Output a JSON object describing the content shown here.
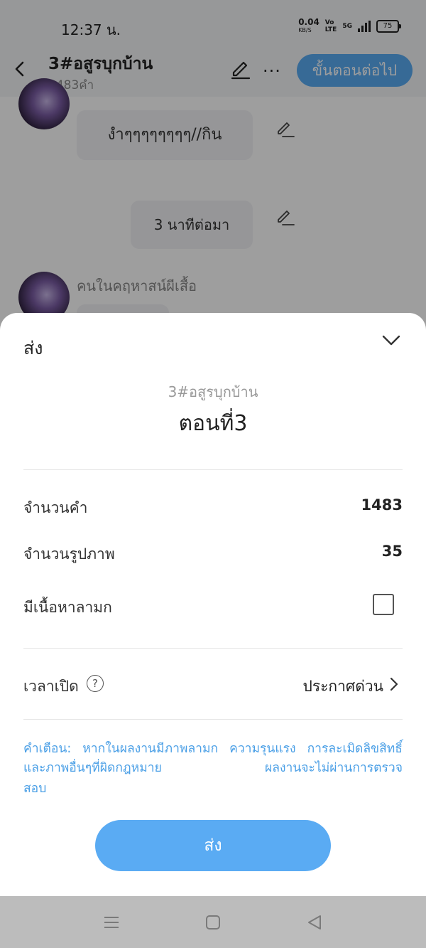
{
  "status_bar": {
    "time": "12:37 น.",
    "net_speed_value": "0.04",
    "net_speed_unit": "KB/S",
    "volte_top": "Vo",
    "volte_bottom": "LTE",
    "network": "5G",
    "battery": "75"
  },
  "header": {
    "title": "3#อสูรบุกบ้าน",
    "word_count": "1483คำ",
    "next_button": "ขั้นตอนต่อไป"
  },
  "chat": {
    "bubble_1": "งำๆๆๆๆๆๆๆๆ//กิน",
    "bubble_2": "3 นาทีต่อมา",
    "sender": "คนในคฤหาสน์ผีเสื้อ"
  },
  "sheet": {
    "title": "ส่ง",
    "book_name": "3#อสูรบุกบ้าน",
    "chapter_name": "ตอนที่3",
    "rows": {
      "word_count_label": "จำนวนคำ",
      "word_count_value": "1483",
      "image_count_label": "จำนวนรูปภาพ",
      "image_count_value": "35",
      "adult_label": "มีเนื้อหาลามก",
      "adult_checked": false,
      "publish_time_label": "เวลาเปิด",
      "publish_time_value": "ประกาศด่วน"
    },
    "warning_line": "คำเตือน: หากในผลงานมีภาพลามก ความรุนแรง การละเมิดลิขสิทธิ์และภาพอื่นๆที่ผิดกฎหมาย ผลงานจะไม่ผ่านการตรวจ",
    "warning_end": "สอบ",
    "send_button": "ส่ง"
  },
  "colors": {
    "accent": "#5aabf3",
    "warning_text": "#4a9fe6"
  }
}
